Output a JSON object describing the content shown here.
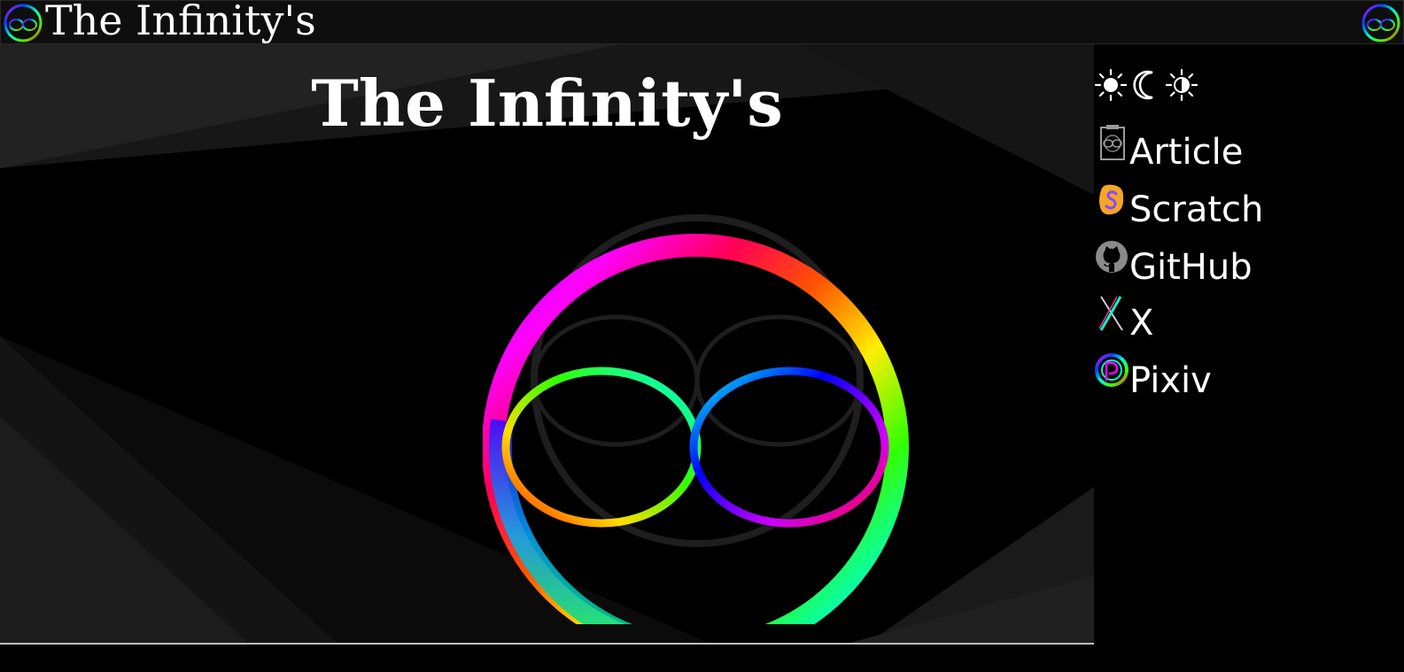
{
  "header": {
    "title": "The Infinity's"
  },
  "hero": {
    "title": "The Infinity's"
  },
  "theme_switch": {
    "light": "☀",
    "dark": "☾",
    "auto": "☀"
  },
  "sidebar": {
    "items": [
      {
        "label": "Article",
        "icon": "article-icon"
      },
      {
        "label": "Scratch",
        "icon": "scratch-icon"
      },
      {
        "label": "GitHub",
        "icon": "github-icon"
      },
      {
        "label": "X",
        "icon": "x-icon"
      },
      {
        "label": "Pixiv",
        "icon": "pixiv-icon"
      }
    ]
  },
  "colors": {
    "background": "#000000",
    "header_bg": "#0e0e0e",
    "text": "#ffffff",
    "scratch_orange": "#f5a623",
    "divider": "#bdbdbd"
  }
}
